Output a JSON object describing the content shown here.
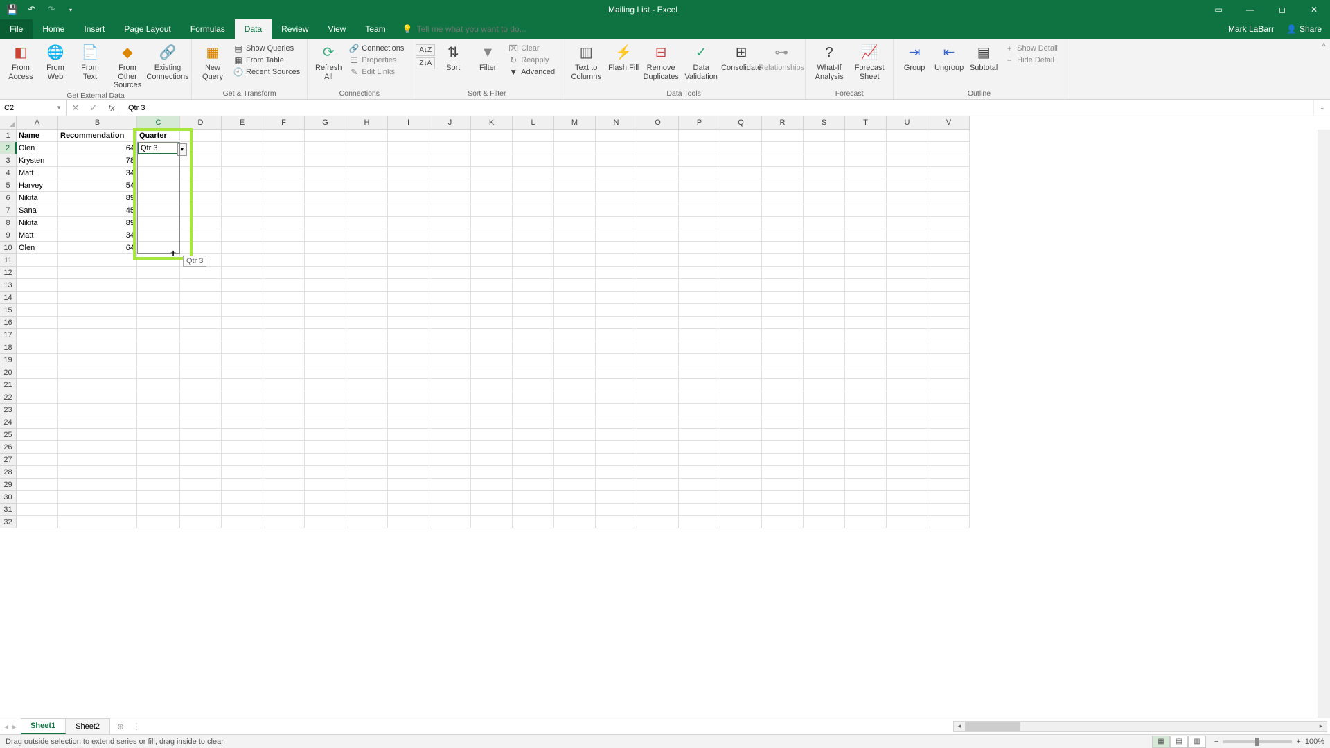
{
  "app": {
    "title": "Mailing List - Excel",
    "user": "Mark LaBarr",
    "share": "Share"
  },
  "tabs": [
    "File",
    "Home",
    "Insert",
    "Page Layout",
    "Formulas",
    "Data",
    "Review",
    "View",
    "Team"
  ],
  "active_tab": "Data",
  "tellme_placeholder": "Tell me what you want to do...",
  "ribbon": {
    "external": {
      "label": "Get External Data",
      "from_access": "From Access",
      "from_web": "From Web",
      "from_text": "From Text",
      "from_other": "From Other Sources",
      "existing": "Existing Connections"
    },
    "transform": {
      "label": "Get & Transform",
      "new_query": "New Query",
      "show_queries": "Show Queries",
      "from_table": "From Table",
      "recent": "Recent Sources"
    },
    "connections": {
      "label": "Connections",
      "refresh": "Refresh All",
      "connections": "Connections",
      "properties": "Properties",
      "edit_links": "Edit Links"
    },
    "sortfilter": {
      "label": "Sort & Filter",
      "sort": "Sort",
      "filter": "Filter",
      "clear": "Clear",
      "reapply": "Reapply",
      "advanced": "Advanced"
    },
    "datatools": {
      "label": "Data Tools",
      "text_to_columns": "Text to Columns",
      "flash_fill": "Flash Fill",
      "remove_dup": "Remove Duplicates",
      "validation": "Data Validation",
      "consolidate": "Consolidate",
      "relationships": "Relationships"
    },
    "forecast": {
      "label": "Forecast",
      "whatif": "What-If Analysis",
      "sheet": "Forecast Sheet"
    },
    "outline": {
      "label": "Outline",
      "group": "Group",
      "ungroup": "Ungroup",
      "subtotal": "Subtotal",
      "show_detail": "Show Detail",
      "hide_detail": "Hide Detail"
    }
  },
  "namebox": "C2",
  "formula": "Qtr 3",
  "columns": [
    "A",
    "B",
    "C",
    "D",
    "E",
    "F",
    "G",
    "H",
    "I",
    "J",
    "K",
    "L",
    "M",
    "N",
    "O",
    "P",
    "Q",
    "R",
    "S",
    "T",
    "U",
    "V"
  ],
  "col_widths": {
    "A": 60,
    "B": 114,
    "C": 62,
    "default": 60
  },
  "table": {
    "headers": [
      "Name",
      "Recommendation",
      "Quarter"
    ],
    "rows": [
      {
        "name": "Olen",
        "rec": 64
      },
      {
        "name": "Krysten",
        "rec": 78
      },
      {
        "name": "Matt",
        "rec": 34
      },
      {
        "name": "Harvey",
        "rec": 54
      },
      {
        "name": "Nikita",
        "rec": 89
      },
      {
        "name": "Sana",
        "rec": 45
      },
      {
        "name": "Nikita",
        "rec": 89
      },
      {
        "name": "Matt",
        "rec": 34
      },
      {
        "name": "Olen",
        "rec": 64
      }
    ],
    "c2_value": "Qtr 3"
  },
  "drag_tooltip": "Qtr 3",
  "sheets": [
    "Sheet1",
    "Sheet2"
  ],
  "active_sheet": "Sheet1",
  "status": "Drag outside selection to extend series or fill; drag inside to clear",
  "zoom": "100%"
}
